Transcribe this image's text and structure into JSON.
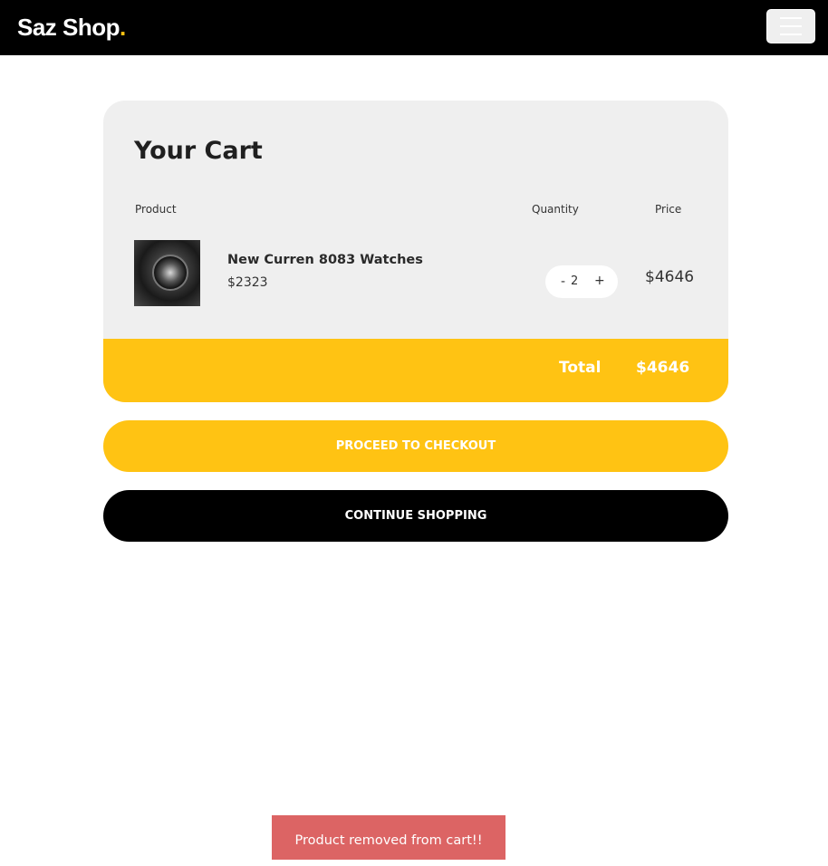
{
  "navbar": {
    "brand_text": "Saz Shop",
    "brand_dot": ".",
    "menu_icon": "hamburger-menu-icon"
  },
  "cart": {
    "title": "Your Cart",
    "columns": {
      "product": "Product",
      "quantity": "Quantity",
      "price": "Price"
    },
    "items": [
      {
        "name": "New Curren 8083 Watches",
        "unit_price": "$2323",
        "quantity": "2",
        "minus_label": "-",
        "plus_label": "+",
        "line_price": "$4646",
        "image_icon": "watch-product-image"
      }
    ],
    "total_label": "Total",
    "total_value": "$4646"
  },
  "actions": {
    "checkout_label": "PROCEED TO CHECKOUT",
    "continue_label": "CONTINUE SHOPPING"
  },
  "toast": {
    "message": "Product removed from cart!!"
  },
  "colors": {
    "accent": "#ffc313",
    "navbar_bg": "#000000",
    "card_bg": "#efefef",
    "toast_bg": "#dc6464"
  }
}
